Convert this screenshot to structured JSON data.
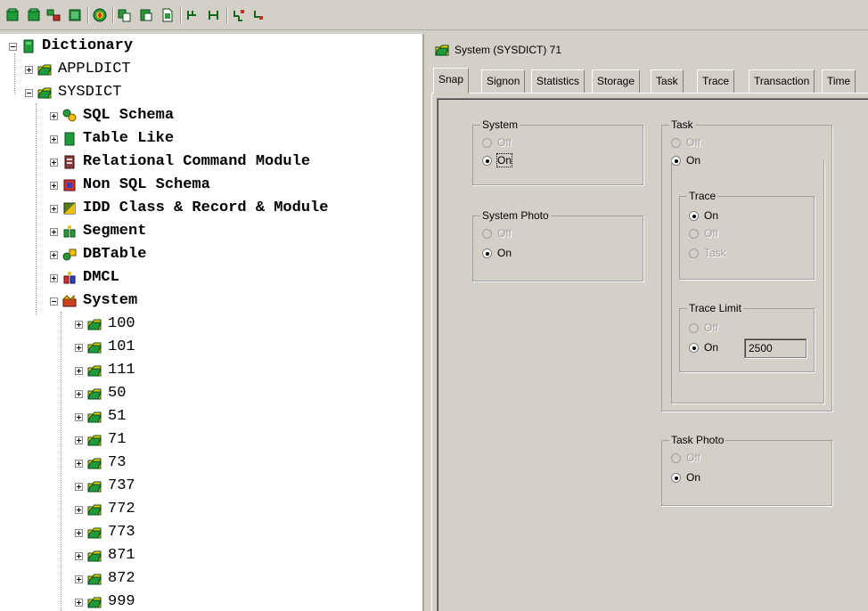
{
  "toolbar": {
    "buttons": [
      {
        "name": "green-cube-icon",
        "color": "#1a8a3a"
      },
      {
        "name": "green-cube-icon",
        "color": "#1a8a3a"
      },
      {
        "name": "module-icon",
        "color": "#2a7a2a"
      },
      {
        "name": "table-icon",
        "color": "#2a7a2a"
      },
      {
        "name": "compass-icon",
        "color": "#c89a00"
      },
      {
        "name": "copy-icon",
        "color": "#2a6a2a"
      },
      {
        "name": "paste-icon",
        "color": "#2a6a2a"
      },
      {
        "name": "document-icon",
        "color": "#2a6a2a"
      },
      {
        "name": "hierarchy-icon",
        "color": "#2a6a2a"
      },
      {
        "name": "hierarchy-icon",
        "color": "#2a6a2a"
      },
      {
        "name": "branch-icon",
        "color": "#2a6a2a"
      },
      {
        "name": "branch-icon",
        "color": "#2a6a2a"
      }
    ]
  },
  "tree": {
    "root": "Dictionary",
    "applldict": "APPLDICT",
    "sysdict": "SYSDICT",
    "categories": [
      {
        "label": "SQL Schema",
        "icon": "sql-schema-icon"
      },
      {
        "label": "Table Like",
        "icon": "table-icon"
      },
      {
        "label": "Relational Command Module",
        "icon": "command-module-icon"
      },
      {
        "label": "Non SQL Schema",
        "icon": "non-sql-schema-icon"
      },
      {
        "label": "IDD Class & Record & Module",
        "icon": "idd-class-icon"
      },
      {
        "label": "Segment",
        "icon": "segment-icon"
      },
      {
        "label": "DBTable",
        "icon": "dbtable-icon"
      },
      {
        "label": "DMCL",
        "icon": "dmcl-icon"
      },
      {
        "label": "System",
        "icon": "system-icon"
      }
    ],
    "systems": [
      "100",
      "101",
      "111",
      "50",
      "51",
      "71",
      "73",
      "737",
      "772",
      "773",
      "871",
      "872",
      "999"
    ]
  },
  "panel": {
    "title": "System (SYSDICT) 71",
    "tabs": [
      "Snap",
      "Signon",
      "Statistics",
      "Storage",
      "Task",
      "Trace",
      "Transaction",
      "Time"
    ],
    "active_tab": "Snap",
    "system": {
      "label": "System",
      "off": "Off",
      "on": "On",
      "selected": "On"
    },
    "system_photo": {
      "label": "System Photo",
      "off": "Off",
      "on": "On",
      "selected": "On"
    },
    "task": {
      "label": "Task",
      "off": "Off",
      "on": "On",
      "selected": "On"
    },
    "trace": {
      "label": "Trace",
      "on": "On",
      "off": "Off",
      "task": "Task",
      "selected": "On"
    },
    "trace_limit": {
      "label": "Trace Limit",
      "off": "Off",
      "on": "On",
      "selected": "On",
      "value": "2500"
    },
    "task_photo": {
      "label": "Task Photo",
      "off": "Off",
      "on": "On",
      "selected": "On"
    }
  }
}
